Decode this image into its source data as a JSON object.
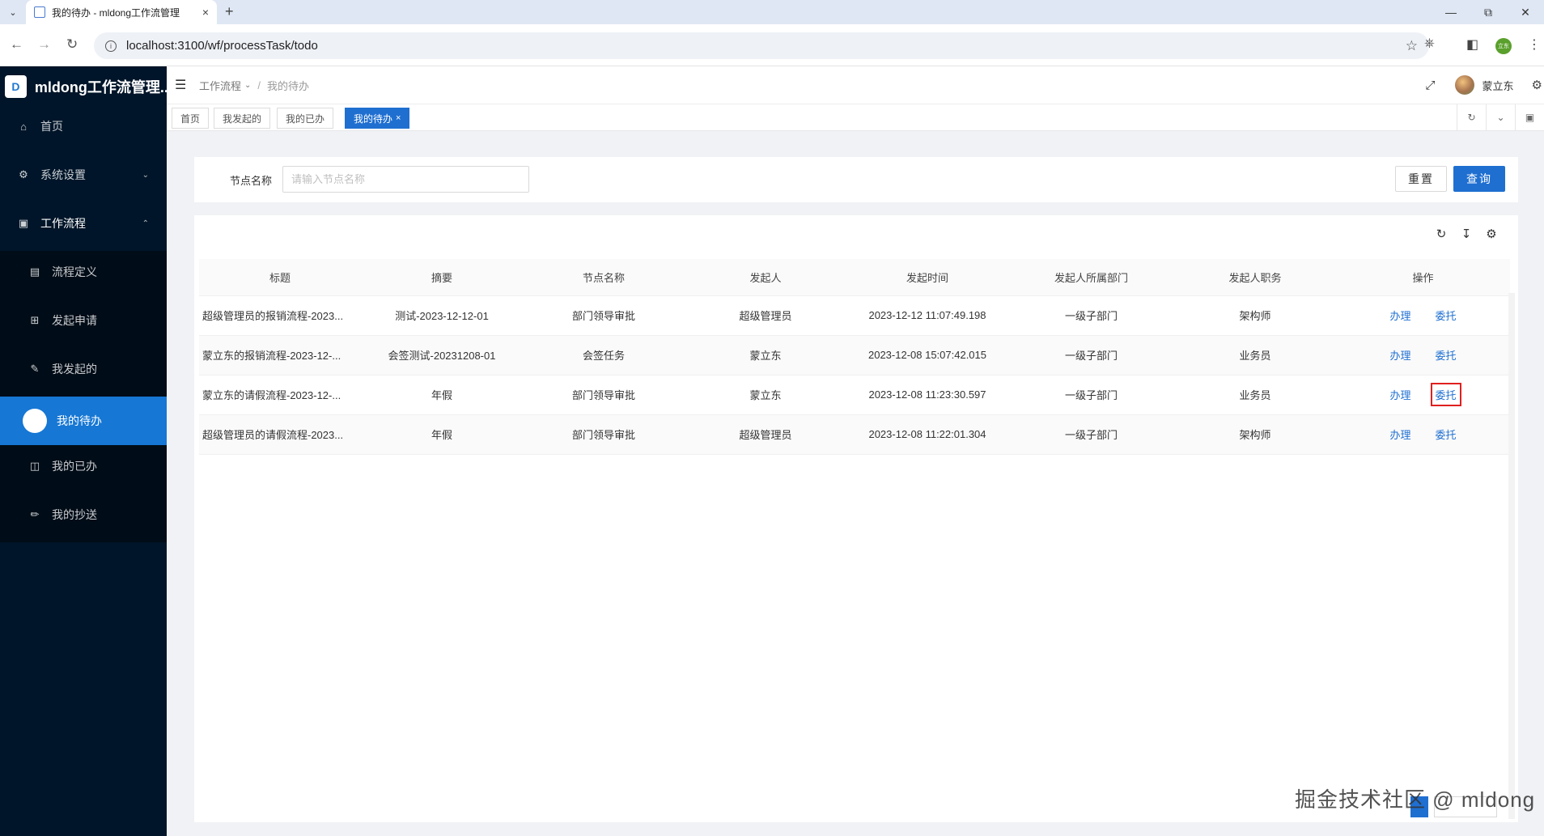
{
  "browser": {
    "tab_title": "我的待办 - mldong工作流管理",
    "tab_close": "×",
    "new_tab": "+",
    "url": "localhost:3100/wf/processTask/todo",
    "profile_text": "立东"
  },
  "app": {
    "logo_letter": "D",
    "name": "mldong工作流管理..."
  },
  "sidebar": {
    "home": "首页",
    "system_settings": "系统设置",
    "workflow": "工作流程",
    "process_definition": "流程定义",
    "start_request": "发起申请",
    "my_started": "我发起的",
    "my_todo": "我的待办",
    "my_done": "我的已办",
    "my_cc": "我的抄送"
  },
  "header": {
    "breadcrumb_parent": "工作流程",
    "breadcrumb_current": "我的待办",
    "username": "蒙立东"
  },
  "page_tags": {
    "home": "首页",
    "my_started": "我发起的",
    "my_done": "我的已办",
    "my_todo": "我的待办",
    "close": "×"
  },
  "search": {
    "label": "节点名称",
    "placeholder": "请输入节点名称",
    "reset": "重置",
    "query": "查询"
  },
  "table": {
    "columns": [
      "标题",
      "摘要",
      "节点名称",
      "发起人",
      "发起时间",
      "发起人所属部门",
      "发起人职务",
      "操作"
    ],
    "rows": [
      {
        "title": "超级管理员的报销流程-2023...",
        "summary": "测试-2023-12-12-01",
        "node": "部门领导审批",
        "initiator": "超级管理员",
        "time": "2023-12-12 11:07:49.198",
        "dept": "一级子部门",
        "position": "架构师",
        "action_handle": "办理",
        "action_delegate": "委托"
      },
      {
        "title": "蒙立东的报销流程-2023-12-...",
        "summary": "会签测试-20231208-01",
        "node": "会签任务",
        "initiator": "蒙立东",
        "time": "2023-12-08 15:07:42.015",
        "dept": "一级子部门",
        "position": "业务员",
        "action_handle": "办理",
        "action_delegate": "委托"
      },
      {
        "title": "蒙立东的请假流程-2023-12-...",
        "summary": "年假",
        "node": "部门领导审批",
        "initiator": "蒙立东",
        "time": "2023-12-08 11:23:30.597",
        "dept": "一级子部门",
        "position": "业务员",
        "action_handle": "办理",
        "action_delegate": "委托"
      },
      {
        "title": "超级管理员的请假流程-2023...",
        "summary": "年假",
        "node": "部门领导审批",
        "initiator": "超级管理员",
        "time": "2023-12-08 11:22:01.304",
        "dept": "一级子部门",
        "position": "架构师",
        "action_handle": "办理",
        "action_delegate": "委托"
      }
    ]
  },
  "watermark": "掘金技术社区 @ mldong",
  "colors": {
    "sidebar_bg": "#001529",
    "primary": "#1f6fd1",
    "highlight_border": "#e02020"
  }
}
